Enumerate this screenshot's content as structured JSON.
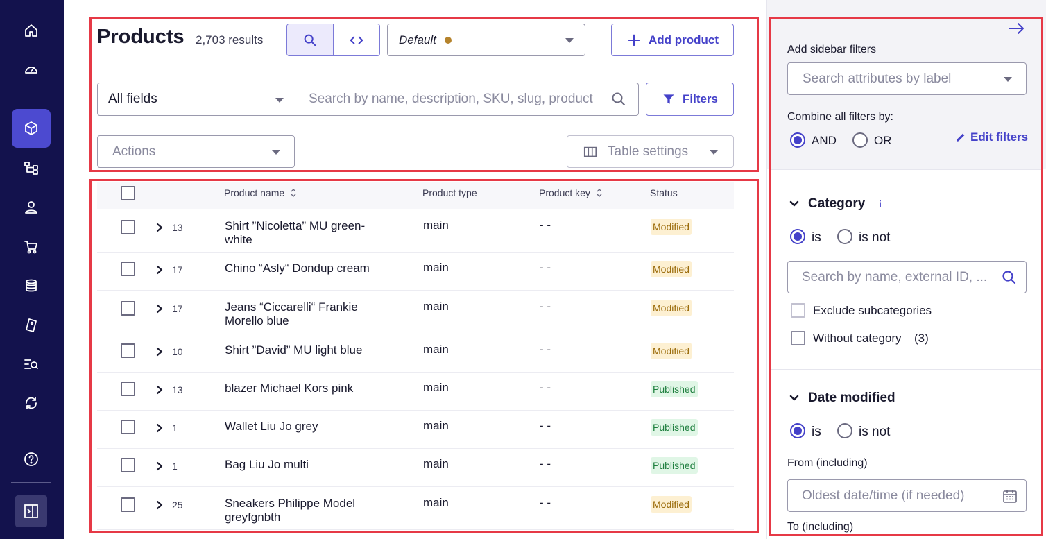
{
  "page": {
    "title": "Products",
    "results": "2,703 results"
  },
  "view": {
    "selected": "Default",
    "dot_color": "#b5832c"
  },
  "toolbar": {
    "add_product": "Add product",
    "field_select": "All fields",
    "search_placeholder": "Search by name, description, SKU, slug, product key",
    "filters": "Filters",
    "actions": "Actions",
    "table_settings": "Table settings"
  },
  "table": {
    "headers": {
      "product_name": "Product name",
      "product_type": "Product type",
      "product_key": "Product key",
      "status": "Status"
    },
    "rows": [
      {
        "count": "13",
        "name": "Shirt ”Nicoletta” MU green-white",
        "type": "main",
        "key": "- -",
        "status": "Modified"
      },
      {
        "count": "17",
        "name": "Chino “Asly“ Dondup cream",
        "type": "main",
        "key": "- -",
        "status": "Modified"
      },
      {
        "count": "17",
        "name": "Jeans “Ciccarelli“ Frankie Morello blue",
        "type": "main",
        "key": "- -",
        "status": "Modified"
      },
      {
        "count": "10",
        "name": "Shirt ”David” MU light blue",
        "type": "main",
        "key": "- -",
        "status": "Modified"
      },
      {
        "count": "13",
        "name": "blazer Michael Kors pink",
        "type": "main",
        "key": "- -",
        "status": "Published"
      },
      {
        "count": "1",
        "name": "Wallet Liu Jo grey",
        "type": "main",
        "key": "- -",
        "status": "Published"
      },
      {
        "count": "1",
        "name": "Bag Liu Jo multi",
        "type": "main",
        "key": "- -",
        "status": "Published"
      },
      {
        "count": "25",
        "name": "Sneakers Philippe Model greyfgnbth",
        "type": "main",
        "key": "- -",
        "status": "Modified"
      }
    ]
  },
  "sidebar": {
    "add_filters_label": "Add sidebar filters",
    "search_attributes_placeholder": "Search attributes by label",
    "combine_label": "Combine all filters by:",
    "and_label": "AND",
    "or_label": "OR",
    "edit_filters": "Edit filters",
    "category": {
      "title": "Category",
      "info": "i",
      "is": "is",
      "is_not": "is not",
      "search_placeholder": "Search by name, external ID, ...",
      "exclude_subcategories": "Exclude subcategories",
      "without_category": "Without category",
      "without_category_count": "(3)"
    },
    "date_modified": {
      "title": "Date modified",
      "is": "is",
      "is_not": "is not",
      "from_label": "From (including)",
      "from_placeholder": "Oldest date/time (if needed)",
      "to_label": "To (including)"
    }
  },
  "colors": {
    "nav_bg": "#13124d",
    "accent": "#4441c9",
    "highlight_border": "#e63946"
  }
}
